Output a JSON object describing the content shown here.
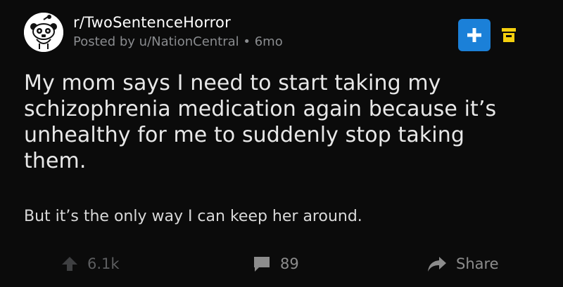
{
  "post": {
    "subreddit": "r/TwoSentenceHorror",
    "posted_by": "Posted by u/NationCentral • 6mo",
    "title": "My mom says I need to start taking my schizophrenia medication again because it’s unhealthy for me to suddenly stop taking them.",
    "body": "But it’s the only way I can keep her around."
  },
  "actions": {
    "upvotes": "6.1k",
    "comments": "89",
    "share": "Share"
  },
  "icons": {
    "avatar": "snoo-avatar-icon",
    "plus": "plus-icon",
    "archive": "archive-icon",
    "upvote": "upvote-arrow-icon",
    "comment": "comment-bubble-icon",
    "share": "share-arrow-icon"
  },
  "colors": {
    "background": "#0b0b0b",
    "accent_blue": "#1b80d8",
    "archive_yellow": "#f5d00e",
    "muted_text": "#8a8c8f"
  }
}
